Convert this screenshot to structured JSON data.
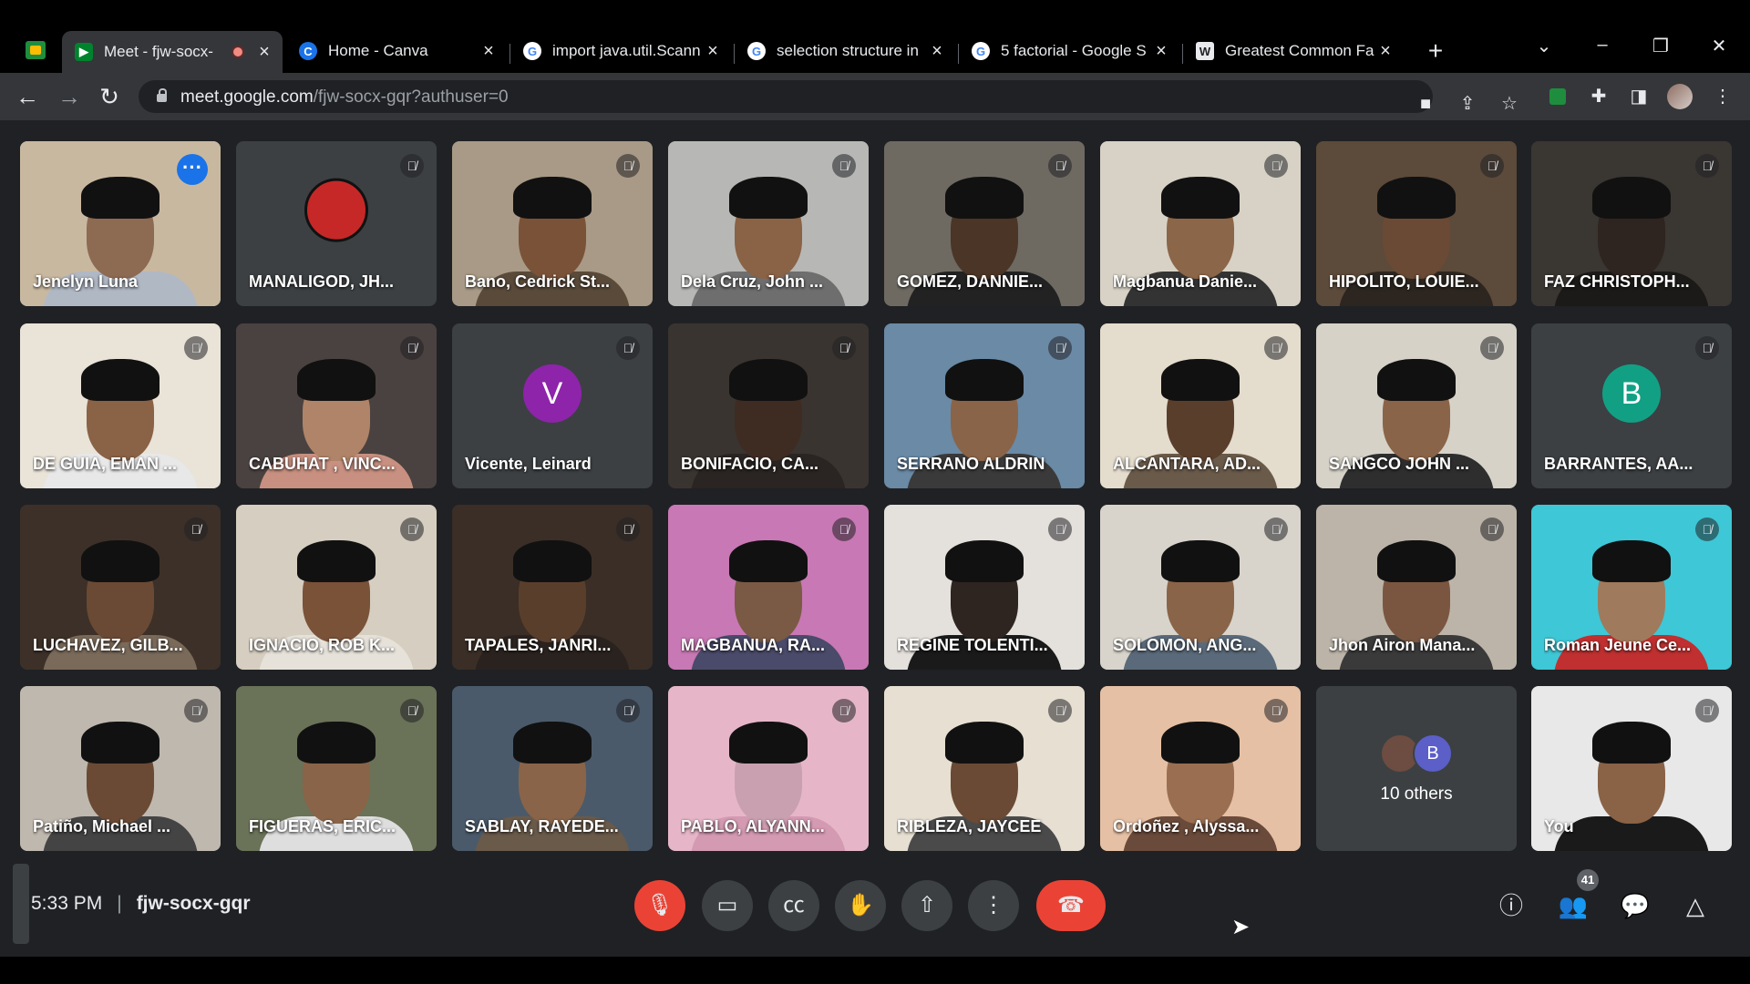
{
  "browser": {
    "tabs": [
      {
        "title": "Meet - fjw-socx-",
        "favicon": "meet-icon",
        "active": true
      },
      {
        "title": "Home - Canva",
        "favicon": "canva-icon"
      },
      {
        "title": "import java.util.Scann",
        "favicon": "google-icon"
      },
      {
        "title": "selection structure in",
        "favicon": "google-icon"
      },
      {
        "title": "5 factorial - Google S",
        "favicon": "google-icon"
      },
      {
        "title": "Greatest Common Fa",
        "favicon": "wiki-icon"
      }
    ],
    "new_tab": "+",
    "url_host": "meet.google.com",
    "url_path": "/fjw-socx-gqr?authuser=0"
  },
  "tiles": [
    {
      "name": "Jenelyn Luna",
      "speaking": true,
      "bg": "#c9b8a0",
      "skin": "#8d6a52",
      "shirt": "#b0b8c4"
    },
    {
      "name": "MANALIGOD, JH...",
      "avatar": "logo",
      "bg": "#3c4043"
    },
    {
      "name": "Bano, Cedrick St...",
      "bg": "#a89a86",
      "skin": "#7a5238",
      "shirt": "#5a4a3a"
    },
    {
      "name": "Dela Cruz, John ...",
      "bg": "#b7b8b5",
      "skin": "#8a6246",
      "shirt": "#6e6e6e"
    },
    {
      "name": "GOMEZ, DANNIE...",
      "bg": "#6e6a62",
      "skin": "#4a3526",
      "shirt": "#222"
    },
    {
      "name": "Magbanua Danie...",
      "bg": "#d8d2c6",
      "skin": "#8c6648",
      "shirt": "#333"
    },
    {
      "name": "HIPOLITO, LOUIE...",
      "bg": "#5c4a3a",
      "skin": "#6a4a34",
      "shirt": "#2d2620"
    },
    {
      "name": "FAZ CHRISTOPH...",
      "bg": "#3a3632",
      "skin": "#2e2420",
      "shirt": "#1c1a18"
    },
    {
      "name": "DE GUIA, EMAN ...",
      "bg": "#e9e3d8",
      "skin": "#8a6246",
      "shirt": "#e8e8e8"
    },
    {
      "name": "CABUHAT , VINC...",
      "bg": "#4a4240",
      "skin": "#b08468",
      "shirt": "#c89080"
    },
    {
      "name": "Vicente, Leinard",
      "avatar": "V",
      "avatar_color": "#8e24aa"
    },
    {
      "name": "BONIFACIO, CA...",
      "bg": "#3a3430",
      "skin": "#3e2c22",
      "shirt": "#2a2522"
    },
    {
      "name": "SERRANO ALDRIN",
      "bg": "#6a8aa6",
      "skin": "#8a6448",
      "shirt": "#3a3a3a"
    },
    {
      "name": "ALCANTARA, AD...",
      "bg": "#e4dccd",
      "skin": "#5a3e2c",
      "shirt": "#6a5a4a"
    },
    {
      "name": "SANGCO JOHN ...",
      "bg": "#d6d2c8",
      "skin": "#8a6448",
      "shirt": "#2e2e2e"
    },
    {
      "name": "BARRANTES, AA...",
      "avatar": "B",
      "avatar_color": "#12a085"
    },
    {
      "name": "LUCHAVEZ, GILB...",
      "bg": "#3c3028",
      "skin": "#6a4a34",
      "shirt": "#7a6a5a"
    },
    {
      "name": "IGNACIO, ROB K...",
      "bg": "#d6cec0",
      "skin": "#7a5238",
      "shirt": "#e6e2da"
    },
    {
      "name": "TAPALES, JANRI...",
      "bg": "#3a2e26",
      "skin": "#5a3e2c",
      "shirt": "#2a221e"
    },
    {
      "name": "MAGBANUA, RA...",
      "bg": "#c878b4",
      "skin": "#7a5a44",
      "shirt": "#4a4a6a"
    },
    {
      "name": "REGINE TOLENTI...",
      "bg": "#e4e0dc",
      "skin": "#2e2420",
      "shirt": "#1a1a1a"
    },
    {
      "name": "SOLOMON, ANG...",
      "bg": "#d8d4cc",
      "skin": "#8a6448",
      "shirt": "#5a6a7a"
    },
    {
      "name": "Jhon Airon Mana...",
      "bg": "#bcb4a8",
      "skin": "#7a5640",
      "shirt": "#3a3a3a"
    },
    {
      "name": "Roman Jeune Ce...",
      "bg": "#3ec7d6",
      "skin": "#a07a5c",
      "shirt": "#c03030"
    },
    {
      "name": "Patiño, Michael ...",
      "bg": "#bfb8ae",
      "skin": "#6a4a34",
      "shirt": "#444"
    },
    {
      "name": "FIGUERAS, ERIC...",
      "bg": "#6a7258",
      "skin": "#8a6448",
      "shirt": "#dedede"
    },
    {
      "name": "SABLAY, RAYEDE...",
      "bg": "#4a5a6a",
      "skin": "#8a6448",
      "shirt": "#6a5a4a"
    },
    {
      "name": "PABLO, ALYANN...",
      "bg": "#e6b6c8",
      "skin": "#c9a0b0",
      "shirt": "#d49ab2"
    },
    {
      "name": "RIBLEZA, JAYCEE",
      "bg": "#e6dfd2",
      "skin": "#6a4a34",
      "shirt": "#4a4a4a"
    },
    {
      "name": "Ordoñez , Alyssa...",
      "bg": "#e6c0a4",
      "skin": "#9a6e50",
      "shirt": "#6a4a3a"
    },
    {
      "others": true,
      "label": "10 others",
      "avatar_letter": "B"
    },
    {
      "name": "You",
      "bg": "#e8e8e8",
      "skin": "#8a6246",
      "shirt": "#1a1a1a",
      "self": true
    }
  ],
  "meeting": {
    "time": "5:33 PM",
    "separator": "|",
    "code": "fjw-socx-gqr",
    "participant_count": "41"
  },
  "colors": {
    "accent": "#8ab4f8",
    "danger": "#ea4335",
    "surface": "#3c4043",
    "background": "#202124"
  }
}
